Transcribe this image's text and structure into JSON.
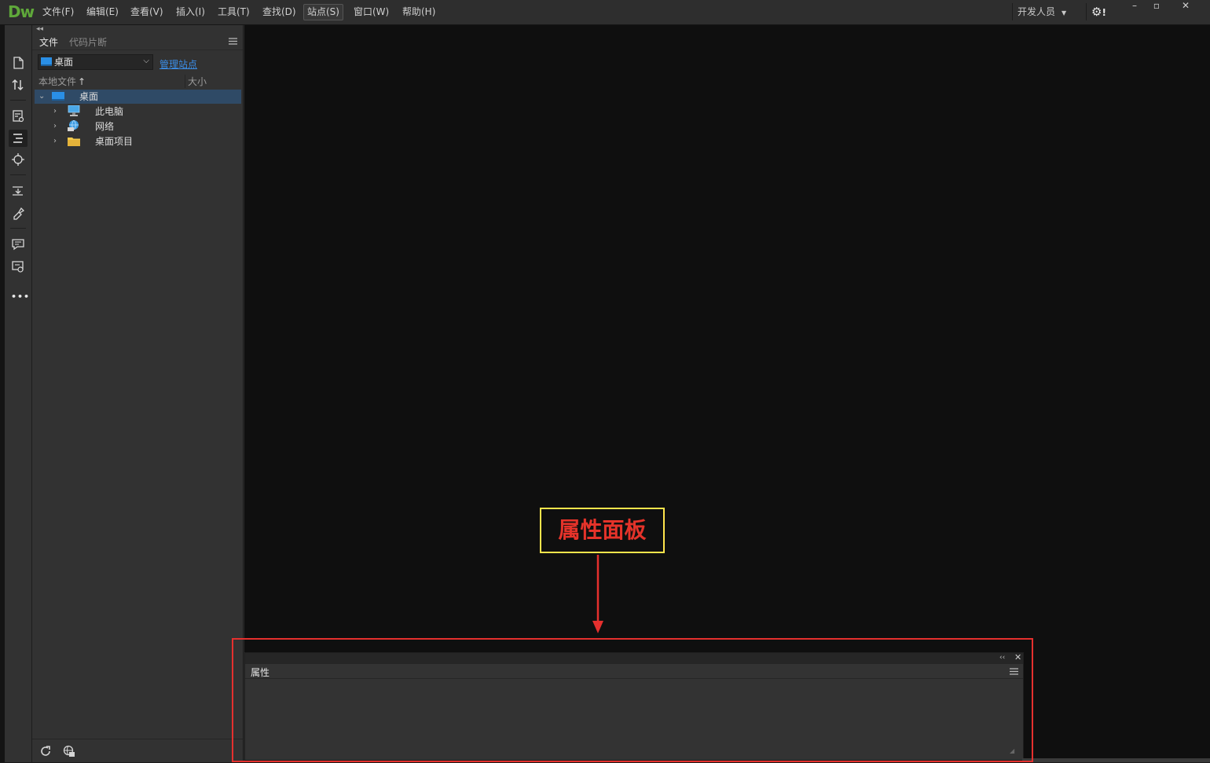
{
  "app": {
    "logo": "Dw",
    "menu": [
      {
        "label": "文件(F)"
      },
      {
        "label": "编辑(E)"
      },
      {
        "label": "查看(V)"
      },
      {
        "label": "插入(I)"
      },
      {
        "label": "工具(T)"
      },
      {
        "label": "查找(D)"
      },
      {
        "label": "站点(S)"
      },
      {
        "label": "窗口(W)"
      },
      {
        "label": "帮助(H)"
      }
    ],
    "workspace": "开发人员",
    "gear_badge": "!",
    "window_controls": {
      "minimize": "–",
      "maximize": "▫",
      "close": "✕"
    }
  },
  "toolstrip": {
    "icons": [
      "new-document-icon",
      "file-transfer-icon",
      "live-view-icon",
      "code-outline-icon",
      "target-icon",
      "element-transfer-icon",
      "brush-icon",
      "comment-icon",
      "image-comment-icon",
      "more-icon"
    ],
    "more_label": "•••"
  },
  "files_panel": {
    "tabs": [
      {
        "label": "文件"
      },
      {
        "label": "代码片断"
      }
    ],
    "site_select": "桌面",
    "manage_site": "管理站点",
    "columns": {
      "local": "本地文件",
      "sort_arrow": "↑",
      "size": "大小"
    },
    "tree": [
      {
        "label": "桌面",
        "level": 0,
        "expanded": true,
        "selected": true,
        "icon": "desktop-icon"
      },
      {
        "label": "此电脑",
        "level": 1,
        "expanded": false,
        "icon": "computer-icon"
      },
      {
        "label": "网络",
        "level": 1,
        "expanded": false,
        "icon": "network-icon"
      },
      {
        "label": "桌面项目",
        "level": 1,
        "expanded": false,
        "icon": "folder-icon"
      }
    ]
  },
  "properties_panel": {
    "tab": "属性",
    "collapse": "‹‹",
    "close": "✕"
  },
  "annotation": {
    "label": "属性面板",
    "colors": {
      "label": "#e5332a",
      "box": "#ffe54c",
      "frame": "#e5302e"
    }
  },
  "colors": {
    "accent": "#5fa83a",
    "link": "#3b8ee8",
    "selection": "#2f4a66"
  }
}
